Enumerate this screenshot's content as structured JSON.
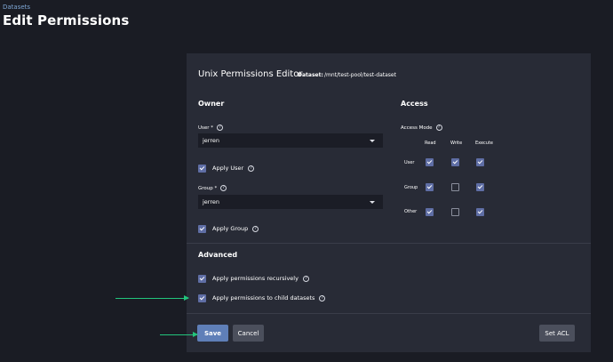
{
  "breadcrumb": "Datasets",
  "page_title": "Edit Permissions",
  "editor": {
    "title": "Unix Permissions Editor",
    "dataset_label": "Dataset:",
    "dataset_path": "/mnt/test-pool/test-dataset"
  },
  "owner": {
    "title": "Owner",
    "user_label": "User *",
    "user_value": "jerren",
    "apply_user": "Apply User",
    "group_label": "Group *",
    "group_value": "jerren",
    "apply_group": "Apply Group"
  },
  "access": {
    "title": "Access",
    "mode_label": "Access Mode",
    "columns": [
      "Read",
      "Write",
      "Execute"
    ],
    "rows": [
      {
        "name": "User",
        "read": true,
        "write": true,
        "execute": true
      },
      {
        "name": "Group",
        "read": true,
        "write": false,
        "execute": true
      },
      {
        "name": "Other",
        "read": true,
        "write": false,
        "execute": true
      }
    ]
  },
  "advanced": {
    "title": "Advanced",
    "recursive_label": "Apply permissions recursively",
    "child_label": "Apply permissions to child datasets"
  },
  "buttons": {
    "save": "Save",
    "cancel": "Cancel",
    "set_acl": "Set ACL"
  },
  "colors": {
    "accent": "#5f7fb8",
    "annotation_arrow": "#22c47c"
  }
}
